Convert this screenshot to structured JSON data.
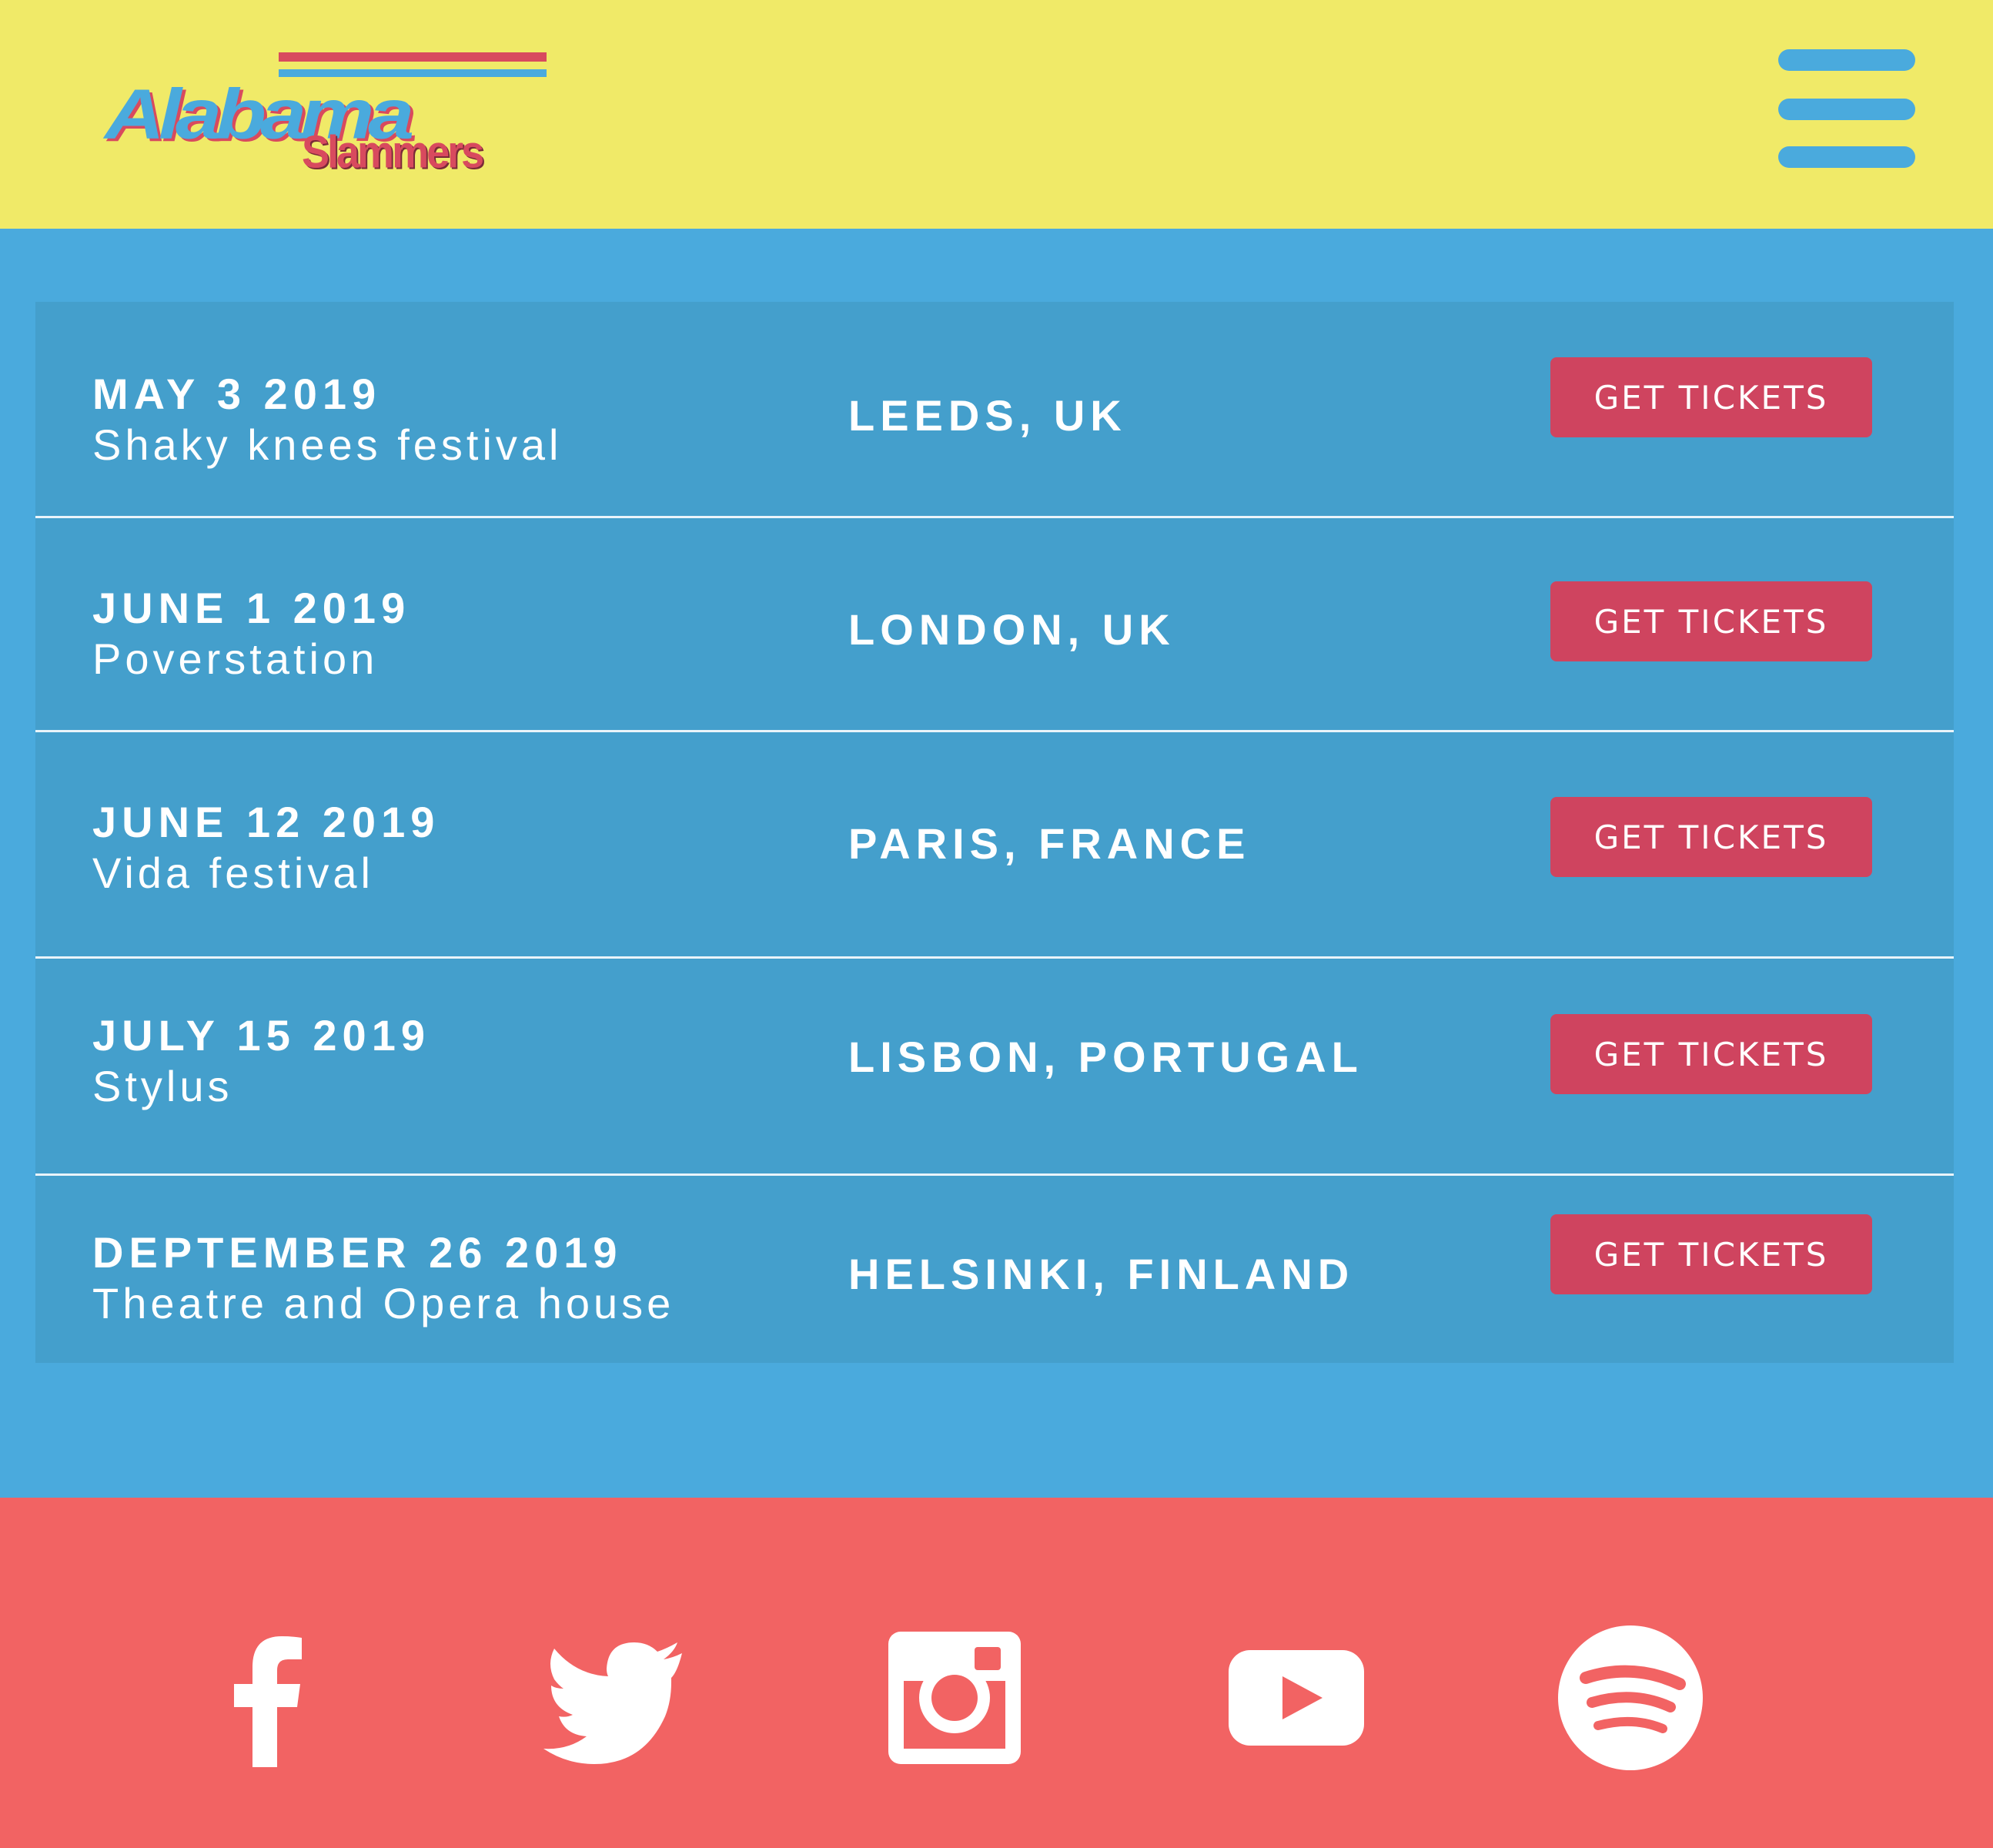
{
  "header": {
    "logo": {
      "main": "Alabama",
      "sub": "Slammers"
    },
    "menu_icon": "hamburger-menu-icon"
  },
  "events": [
    {
      "date": "MAY 3 2019",
      "venue": "Shaky knees festival",
      "city": "LEEDS, UK",
      "button": "GET TICKETS"
    },
    {
      "date": "JUNE 1 2019",
      "venue": "Poverstation",
      "city": "LONDON, UK",
      "button": "GET TICKETS"
    },
    {
      "date": "JUNE 12 2019",
      "venue": "Vida festival",
      "city": "PARIS, FRANCE",
      "button": "GET TICKETS"
    },
    {
      "date": "JULY 15 2019",
      "venue": "Stylus",
      "city": "LISBON, PORTUGAL",
      "button": "GET TICKETS"
    },
    {
      "date": "DEPTEMBER 26 2019",
      "venue": "Theatre and Opera house",
      "city": "HELSINKI, FINLAND",
      "button": "GET TICKETS"
    }
  ],
  "footer": {
    "social_icons": [
      "facebook-icon",
      "twitter-icon",
      "instagram-icon",
      "youtube-icon",
      "spotify-icon"
    ]
  },
  "colors": {
    "header_bg": "#f0ea68",
    "main_bg": "#4aaadd",
    "panel_bg": "#449fcc",
    "button_bg": "#cf445f",
    "footer_bg": "#f26363",
    "text": "#ffffff"
  }
}
